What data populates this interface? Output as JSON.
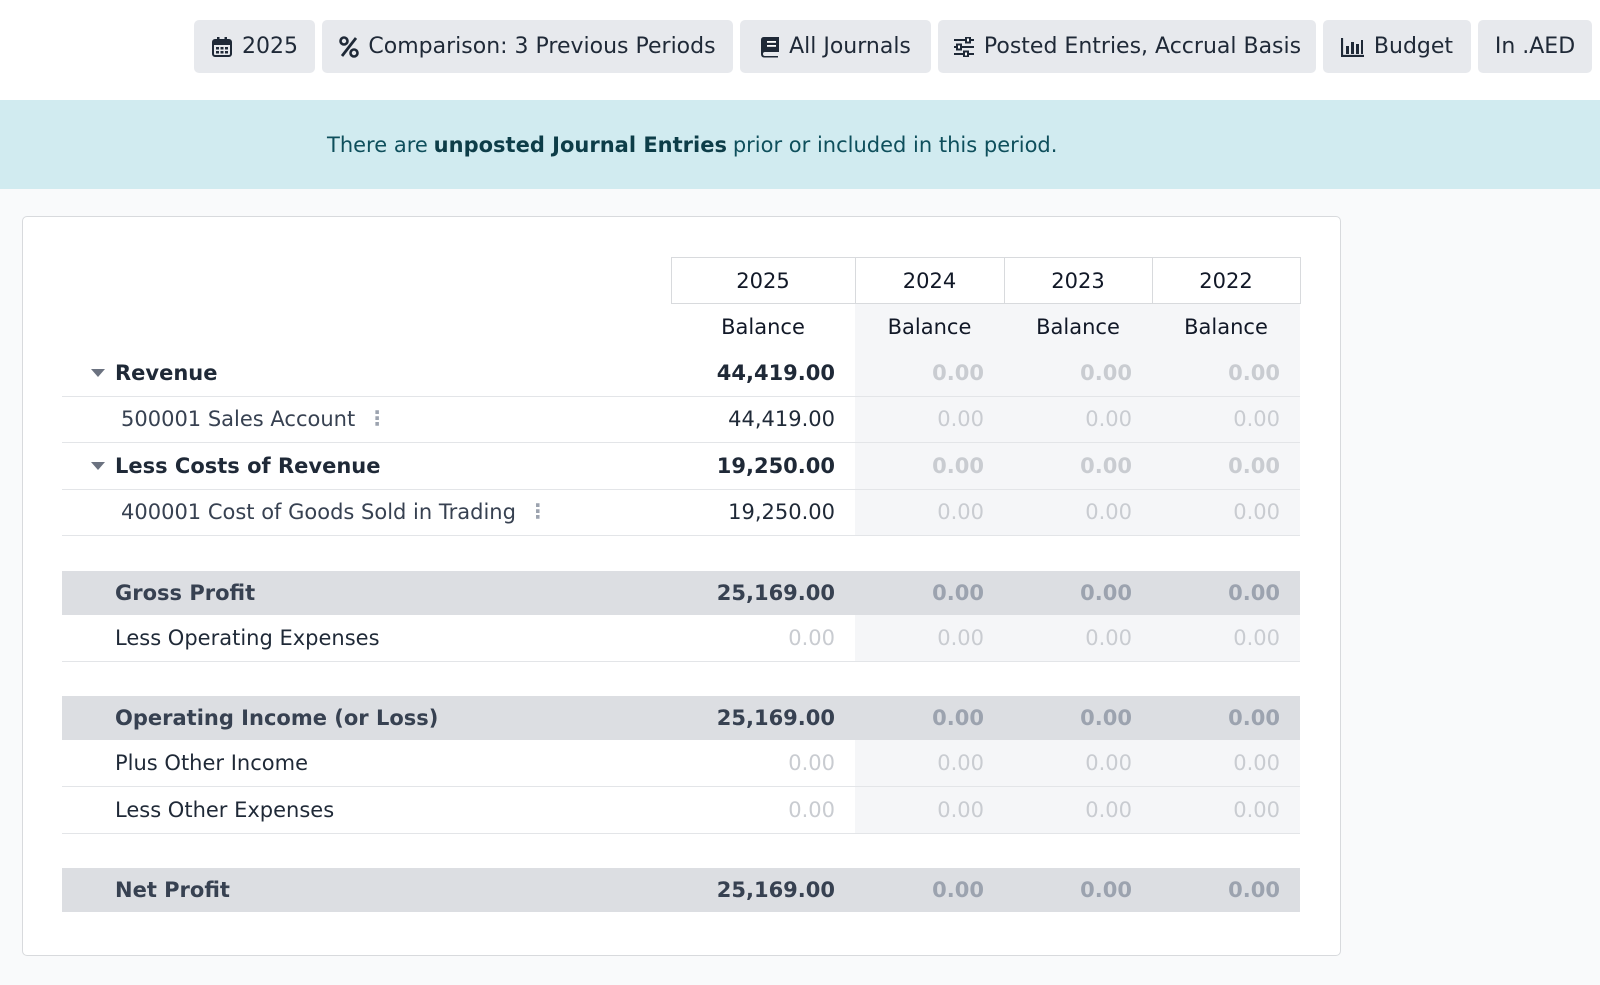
{
  "toolbar": {
    "period": {
      "label": "2025",
      "icon": "calendar-icon"
    },
    "comparison": {
      "label": "Comparison: 3 Previous Periods",
      "icon": "percent-icon"
    },
    "journals": {
      "label": "All Journals",
      "icon": "book-icon"
    },
    "options": {
      "label": "Posted Entries, Accrual Basis",
      "icon": "sliders-icon"
    },
    "budget": {
      "label": "Budget",
      "icon": "bar-chart-icon"
    },
    "currency": {
      "label": "In .AED"
    }
  },
  "alert": {
    "prefix": "There are",
    "link": "unposted Journal Entries",
    "suffix": "prior or included in this period."
  },
  "table": {
    "columns": [
      "2025",
      "2024",
      "2023",
      "2022"
    ],
    "subheader": [
      "Balance",
      "Balance",
      "Balance",
      "Balance"
    ],
    "rows": {
      "revenue": {
        "name": "Revenue",
        "values": [
          "44,419.00",
          "0.00",
          "0.00",
          "0.00"
        ]
      },
      "sales": {
        "name": "500001 Sales Account",
        "values": [
          "44,419.00",
          "0.00",
          "0.00",
          "0.00"
        ]
      },
      "cost": {
        "name": "Less Costs of Revenue",
        "values": [
          "19,250.00",
          "0.00",
          "0.00",
          "0.00"
        ]
      },
      "cogs": {
        "name": "400001 Cost of Goods Sold in Trading",
        "values": [
          "19,250.00",
          "0.00",
          "0.00",
          "0.00"
        ]
      },
      "gross": {
        "name": "Gross Profit",
        "values": [
          "25,169.00",
          "0.00",
          "0.00",
          "0.00"
        ]
      },
      "opex": {
        "name": "Less Operating Expenses",
        "values": [
          "0.00",
          "0.00",
          "0.00",
          "0.00"
        ]
      },
      "opincome": {
        "name": "Operating Income (or Loss)",
        "values": [
          "25,169.00",
          "0.00",
          "0.00",
          "0.00"
        ]
      },
      "otherinc": {
        "name": "Plus Other Income",
        "values": [
          "0.00",
          "0.00",
          "0.00",
          "0.00"
        ]
      },
      "otherexp": {
        "name": "Less Other Expenses",
        "values": [
          "0.00",
          "0.00",
          "0.00",
          "0.00"
        ]
      },
      "net": {
        "name": "Net Profit",
        "values": [
          "25,169.00",
          "0.00",
          "0.00",
          "0.00"
        ]
      }
    }
  },
  "colors": {
    "alert_bg": "#d1ebf0",
    "total_row_bg": "#dcdee2",
    "muted_value": "#c9ccd1"
  }
}
